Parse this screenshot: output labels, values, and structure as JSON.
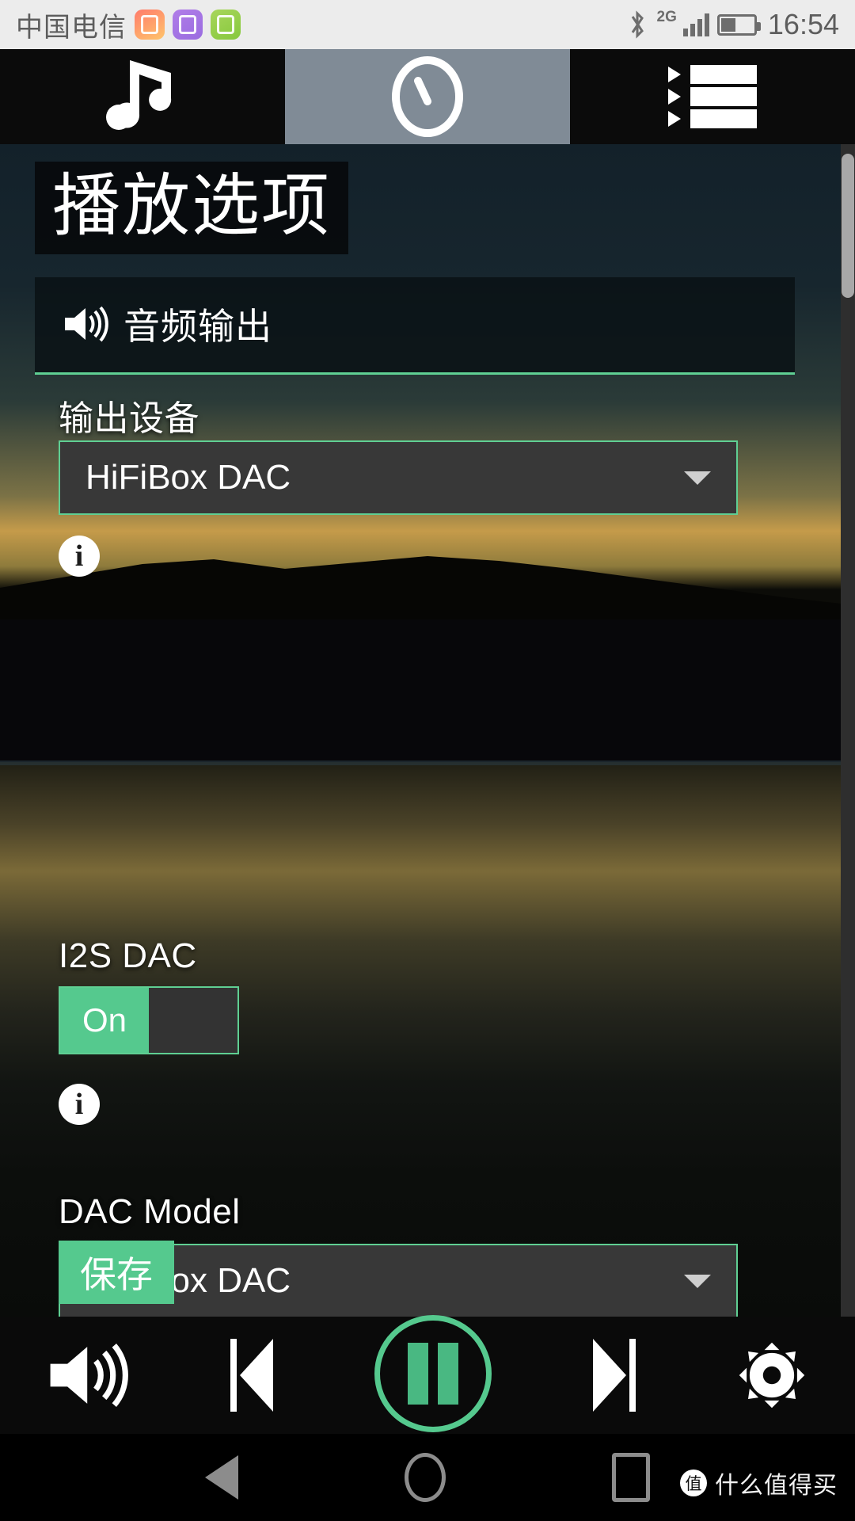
{
  "statusbar": {
    "carrier": "中国电信",
    "network": "2G",
    "time": "16:54",
    "icons": [
      "bluetooth-icon",
      "signal-bars-icon",
      "battery-icon"
    ],
    "app_icons": [
      "health-app-icon",
      "gallery-app-icon",
      "shield-app-icon"
    ]
  },
  "tabs": [
    {
      "name": "music-tab",
      "icon": "music-note-icon",
      "active": false
    },
    {
      "name": "playback-options-tab",
      "icon": "clock-dial-icon",
      "active": true
    },
    {
      "name": "playlist-tab",
      "icon": "playlist-lines-icon",
      "active": false
    }
  ],
  "page": {
    "title": "播放选项"
  },
  "section": {
    "icon": "speaker-volume-icon",
    "heading": "音频输出",
    "accent_color": "#5fcf93"
  },
  "fields": {
    "output_device": {
      "label": "输出设备",
      "value": "HiFiBox DAC",
      "info_icon": "info-icon"
    },
    "i2s_dac": {
      "label": "I2S DAC",
      "on_label": "On",
      "state": "On",
      "info_icon": "info-icon"
    },
    "dac_model": {
      "label": "DAC Model",
      "value": "HiFiBox DAC"
    }
  },
  "save_button": {
    "label": "保存"
  },
  "player": {
    "volume": "volume-icon",
    "previous": "skip-previous-icon",
    "playpause": "pause-icon",
    "next": "skip-next-icon",
    "settings": "gear-icon"
  },
  "navbar": {
    "back": "back-triangle-icon",
    "home": "home-circle-icon",
    "recents": "recents-square-icon"
  },
  "watermark": {
    "mark": "值",
    "text": "什么值得买"
  },
  "colors": {
    "accent_green": "#5fcf93",
    "toggle_green": "#55c98e",
    "tab_active": "#808b96",
    "field_bg": "#383838"
  }
}
